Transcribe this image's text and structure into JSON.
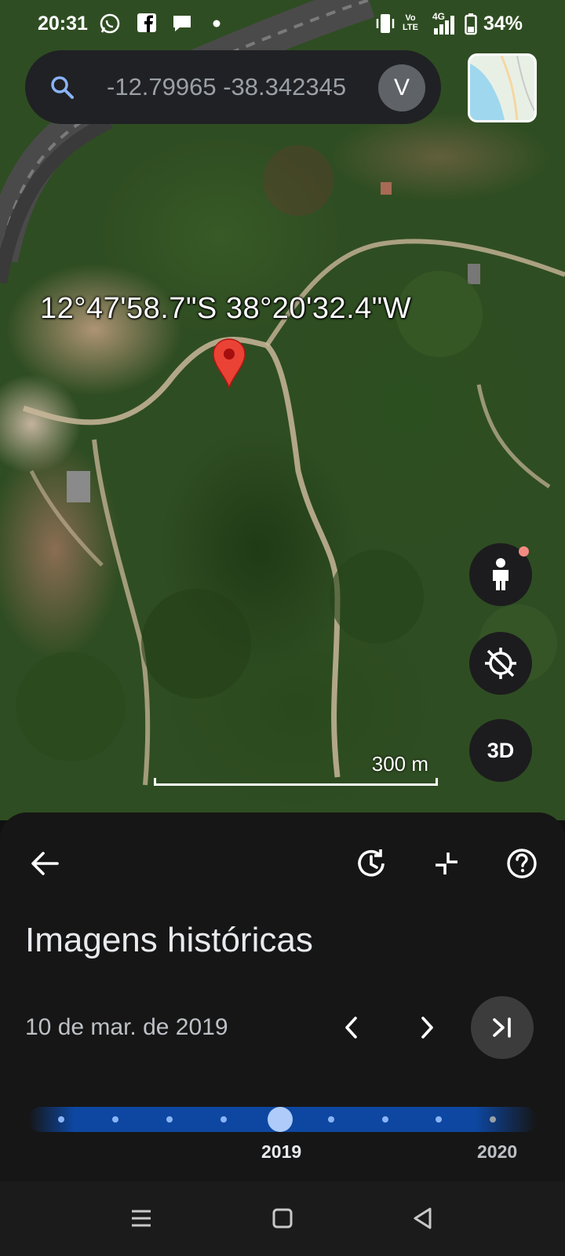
{
  "status_bar": {
    "time": "20:31",
    "notification_icons": [
      "whatsapp-icon",
      "facebook-icon",
      "chat-bubble-icon",
      "dot-icon"
    ],
    "system_icons": [
      "vibrate-icon",
      "volte-icon",
      "signal-4g-icon",
      "battery-icon"
    ],
    "volte_text": "Vo LTE",
    "network_text": "4G",
    "battery": "34%"
  },
  "search": {
    "value": "-12.79965 -38.342345",
    "avatar_letter": "V"
  },
  "map": {
    "coordinates": "12°47'58.7\"S 38°20'32.4\"W",
    "scale_label": "300 m",
    "three_d_label": "3D"
  },
  "panel": {
    "title": "Imagens históricas",
    "date": "10 de mar. de 2019",
    "timeline": {
      "current_year": "2019",
      "next_year": "2020",
      "dot_count": 9,
      "selected_index": 4
    }
  },
  "colors": {
    "accent_blue": "#0d47a1",
    "thumb": "#aecbfa",
    "pin_red": "#ea4335",
    "panel_bg": "#161616"
  }
}
